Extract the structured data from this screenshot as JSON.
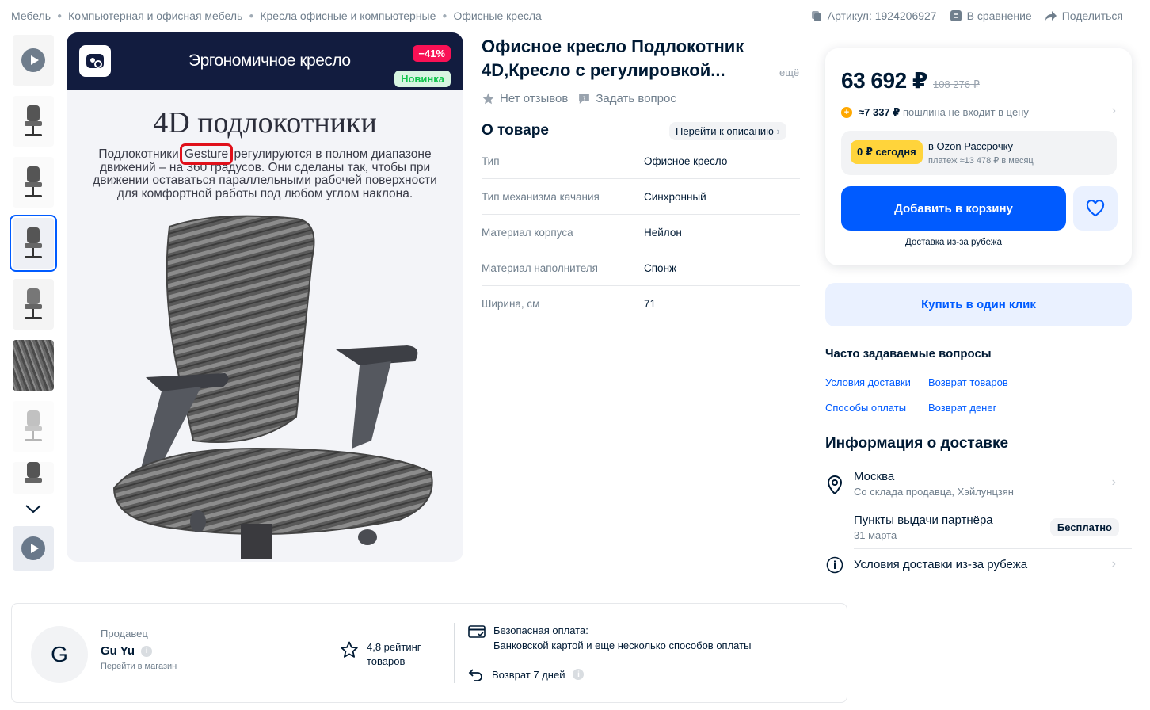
{
  "breadcrumbs": [
    "Мебель",
    "Компьютерная и офисная мебель",
    "Кресла офисные и компьютерные",
    "Офисные кресла"
  ],
  "top_actions": {
    "article": "Артикул: 1924206927",
    "compare": "В сравнение",
    "share": "Поделиться"
  },
  "image": {
    "banner_title": "Эргономичное кресло",
    "discount": "−41%",
    "new_badge": "Новинка",
    "heading": "4D подлокотники",
    "desc_before": "Подлокотники ",
    "desc_highlight": "Gesture",
    "desc_after": " регулируются в полном диапазоне движений – на 360 градусов. Они сделаны так, чтобы при движении оставаться параллельными рабочей поверхности для комфортной работы под любом углом наклона."
  },
  "product": {
    "title": "Офисное кресло Подлокотник 4D,Кресло с регулировкой...",
    "more": "ещё",
    "no_reviews": "Нет отзывов",
    "ask_question": "Задать вопрос",
    "about_heading": "О товаре",
    "to_description": "Перейти к описанию",
    "specs": [
      {
        "key": "Тип",
        "value": "Офисное кресло"
      },
      {
        "key": "Тип механизма качания",
        "value": "Синхронный"
      },
      {
        "key": "Материал корпуса",
        "value": "Нейлон"
      },
      {
        "key": "Материал наполнителя",
        "value": "Спонж"
      },
      {
        "key": "Ширина, см",
        "value": "71"
      }
    ]
  },
  "price": {
    "current": "63 692 ₽",
    "old": "108 276 ₽",
    "duty_amount": "≈7 337 ₽",
    "duty_text": "пошлина не входит в цену",
    "installment_pill": "0 ₽ сегодня",
    "installment_title": "в Ozon Рассрочку",
    "installment_sub": "платеж ≈13 478 ₽ в месяц",
    "add_to_cart": "Добавить в корзину",
    "shipping_note": "Доставка из-за рубежа",
    "buy_one_click": "Купить в один клик"
  },
  "faq": {
    "heading": "Часто задаваемые вопросы",
    "links": [
      "Условия доставки",
      "Возврат товаров",
      "Способы оплаты",
      "Возврат денег"
    ]
  },
  "delivery": {
    "heading": "Информация о доставке",
    "city": "Москва",
    "city_sub": "Со склада продавца, Хэйлунцзян",
    "pickup": "Пункты выдачи партнёра",
    "pickup_date": "31 марта",
    "pickup_price": "Бесплатно",
    "terms": "Условия доставки из-за рубежа"
  },
  "seller": {
    "label": "Продавец",
    "avatar_letter": "G",
    "name": "Gu Yu",
    "go_store": "Перейти в магазин",
    "rating_line1": "4,8 рейтинг",
    "rating_line2": "товаров",
    "payment_title": "Безопасная оплата:",
    "payment_text": "Банковской картой и еще несколько способов оплаты",
    "return_text": "Возврат 7 дней"
  },
  "colors": {
    "accent": "#005bff",
    "discount": "#f91155",
    "new": "#10c44c",
    "installment": "#ffd43b"
  }
}
